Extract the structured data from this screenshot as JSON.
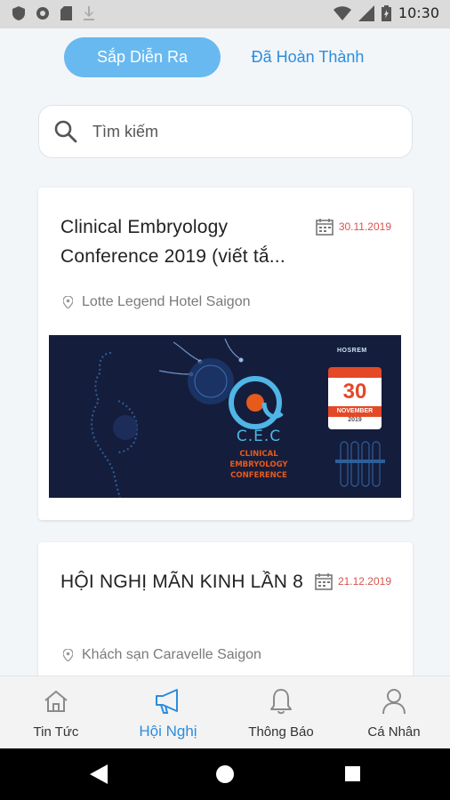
{
  "status_bar": {
    "time": "10:30"
  },
  "tabs": {
    "upcoming": "Sắp Diễn Ra",
    "completed": "Đã Hoàn Thành"
  },
  "search": {
    "placeholder": "Tìm kiếm"
  },
  "conferences": [
    {
      "title": "Clinical Embryology Conference 2019 (viết tắ...",
      "date": "30.11.2019",
      "location": "Lotte Legend Hotel Saigon",
      "banner": {
        "brand": "HOSREM",
        "acronym": "C.E.C",
        "subtitle_1": "CLINICAL",
        "subtitle_2": "EMBRYOLOGY",
        "subtitle_3": "CONFERENCE",
        "cal_day": "30",
        "cal_month": "NOVEMBER",
        "cal_year": "2019"
      }
    },
    {
      "title": "HỘI NGHỊ MÃN KINH LẦN 8",
      "date": "21.12.2019",
      "location": "Khách sạn Caravelle Saigon"
    }
  ],
  "bottom_nav": [
    {
      "label": "Tin Tức",
      "icon": "home-icon"
    },
    {
      "label": "Hội Nghị",
      "icon": "megaphone-icon"
    },
    {
      "label": "Thông Báo",
      "icon": "bell-icon"
    },
    {
      "label": "Cá Nhân",
      "icon": "user-icon"
    }
  ],
  "colors": {
    "accent": "#2a8ddf",
    "tab_active_bg": "#68b9f0",
    "date_red": "#d9534f"
  }
}
